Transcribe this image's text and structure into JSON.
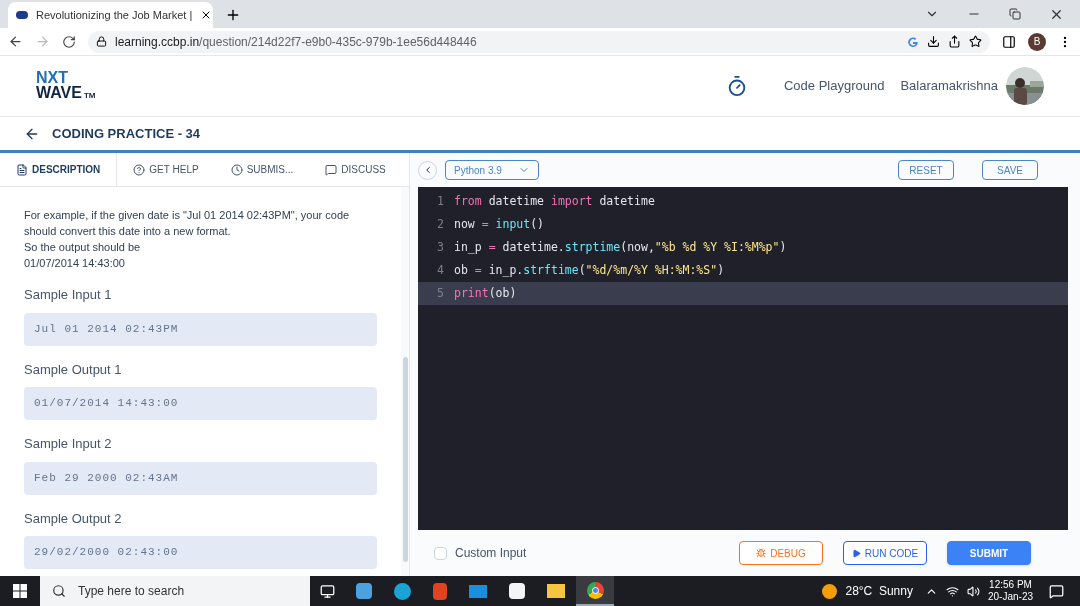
{
  "browser": {
    "tab": {
      "title": "Revolutionizing the Job Market |"
    },
    "address": {
      "domain": "learning.ccbp.in",
      "path": "/question/214d22f7-e9b0-435c-979b-1ee56d448446"
    },
    "profile_initial": "B"
  },
  "header": {
    "logo": {
      "line1": "NXT",
      "line2": "WAVE",
      "mark": "TM"
    },
    "links": [
      "Code Playground"
    ],
    "user": "Balaramakrishna"
  },
  "page_title": "CODING PRACTICE - 34",
  "tabs": [
    {
      "label": "DESCRIPTION",
      "kind": "description",
      "selected": true
    },
    {
      "label": "GET HELP",
      "kind": "help",
      "selected": false
    },
    {
      "label": "SUBMIS...",
      "kind": "submissions",
      "selected": false
    },
    {
      "label": "DISCUSS",
      "kind": "discuss",
      "selected": false
    }
  ],
  "description": {
    "paragraph": [
      "For example, if the given date is \"Jul 01 2014 02:43PM\", your code should convert this date into a new format.",
      "So the output should be",
      "01/07/2014 14:43:00"
    ],
    "samples": [
      {
        "label": "Sample Input 1",
        "value": "Jul 01 2014 02:43PM"
      },
      {
        "label": "Sample Output 1",
        "value": "01/07/2014 14:43:00"
      },
      {
        "label": "Sample Input 2",
        "value": "Feb 29 2000 02:43AM"
      },
      {
        "label": "Sample Output 2",
        "value": "29/02/2000 02:43:00"
      }
    ]
  },
  "editor": {
    "language": "Python 3.9",
    "toolbar_buttons": [
      "RESET",
      "SAVE"
    ],
    "lines": [
      {
        "number": "1",
        "active": false,
        "tokens": [
          {
            "kind": "keyword",
            "text": "from"
          },
          {
            "kind": "plain",
            "text": " datetime "
          },
          {
            "kind": "keyword",
            "text": "import"
          },
          {
            "kind": "plain",
            "text": " datetime"
          }
        ]
      },
      {
        "number": "2",
        "active": false,
        "tokens": [
          {
            "kind": "plain",
            "text": "now "
          },
          {
            "kind": "operator",
            "text": "= "
          },
          {
            "kind": "function",
            "text": "input"
          },
          {
            "kind": "plain",
            "text": "()"
          }
        ]
      },
      {
        "number": "3",
        "active": false,
        "tokens": [
          {
            "kind": "plain",
            "text": "in_p "
          },
          {
            "kind": "operator",
            "text": "="
          },
          {
            "kind": "plain",
            "text": " datetime."
          },
          {
            "kind": "function",
            "text": "strptime"
          },
          {
            "kind": "plain",
            "text": "(now,"
          },
          {
            "kind": "string",
            "text": "\"%b %d %Y %I:%M%p\""
          },
          {
            "kind": "plain",
            "text": ")"
          }
        ]
      },
      {
        "number": "4",
        "active": false,
        "tokens": [
          {
            "kind": "plain",
            "text": "ob "
          },
          {
            "kind": "operator",
            "text": "="
          },
          {
            "kind": "plain",
            "text": " in_p."
          },
          {
            "kind": "function",
            "text": "strftime"
          },
          {
            "kind": "plain",
            "text": "("
          },
          {
            "kind": "string",
            "text": "\"%d/%m/%Y %H:%M:%S\""
          },
          {
            "kind": "plain",
            "text": ")"
          }
        ]
      },
      {
        "number": "5",
        "active": true,
        "tokens": [
          {
            "kind": "keyword",
            "text": "print"
          },
          {
            "kind": "plain",
            "text": "(ob)"
          }
        ]
      }
    ]
  },
  "footer": {
    "custom_input": {
      "label": "Custom Input",
      "checked": false
    },
    "buttons": [
      {
        "label": "DEBUG",
        "kind": "debug"
      },
      {
        "label": "RUN CODE",
        "kind": "run"
      },
      {
        "label": "SUBMIT",
        "kind": "submit"
      }
    ]
  },
  "taskbar": {
    "search_placeholder": "Type here to search",
    "weather": "28°C  Sunny",
    "time": "12:56 PM",
    "date": "20-Jan-23"
  }
}
